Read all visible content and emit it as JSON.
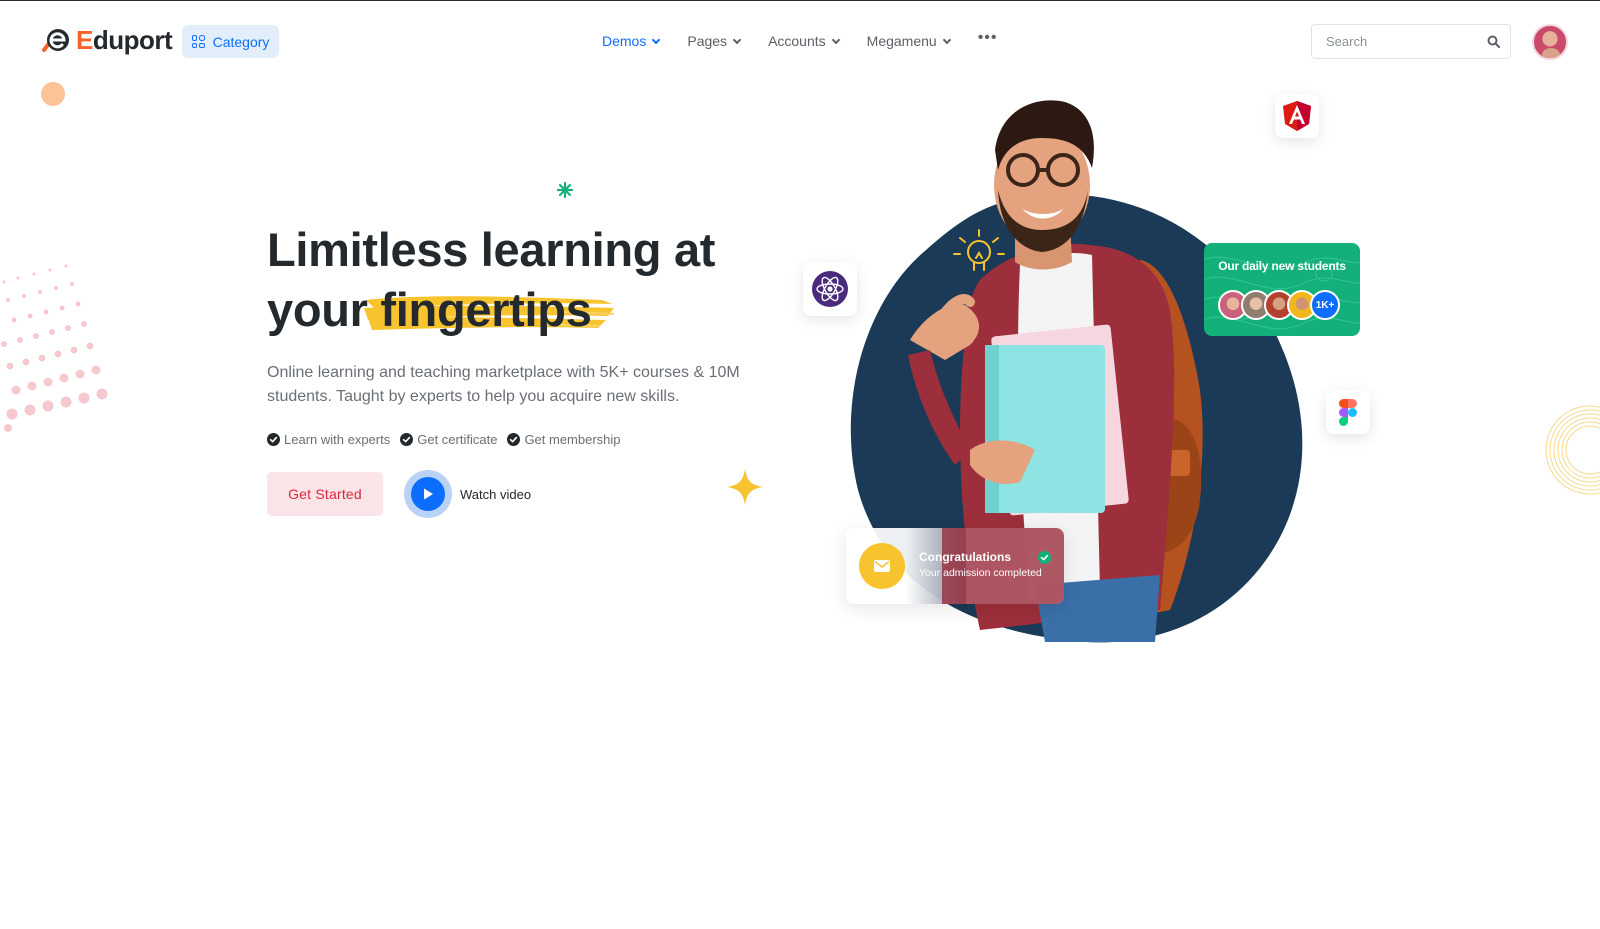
{
  "header": {
    "logo": {
      "prefix": "E",
      "rest": "duport"
    },
    "category_label": "Category",
    "nav": [
      {
        "label": "Demos",
        "active": true
      },
      {
        "label": "Pages",
        "active": false
      },
      {
        "label": "Accounts",
        "active": false
      },
      {
        "label": "Megamenu",
        "active": false
      }
    ],
    "more_label": "•••",
    "search_placeholder": "Search"
  },
  "hero": {
    "title_line1": "Limitless learning at",
    "title_line2_plain": "your",
    "title_line2_highlight": "fingertips",
    "description": "Online learning and teaching marketplace with 5K+ courses & 10M students. Taught by experts to help you acquire new skills.",
    "features": [
      "Learn with experts",
      "Get certificate",
      "Get membership"
    ],
    "cta_primary": "Get Started",
    "cta_video": "Watch video"
  },
  "cards": {
    "students_title": "Our daily new students",
    "students_more": "1K+",
    "congrats_title": "Congratulations",
    "congrats_sub": "Your admission completed"
  },
  "icons": [
    "category-grid-icon",
    "chevron-down-icon",
    "more-dots-icon",
    "search-icon",
    "check-circle-icon",
    "play-icon",
    "react-icon",
    "angular-icon",
    "figma-icon",
    "mail-icon",
    "lightbulb-icon"
  ],
  "colors": {
    "primary": "#0d6efd",
    "accent_orange": "#f7612a",
    "danger": "#d6293e",
    "highlight_yellow": "#f7c32e",
    "success_green": "#14b07a",
    "blob_navy": "#1b3a57"
  }
}
